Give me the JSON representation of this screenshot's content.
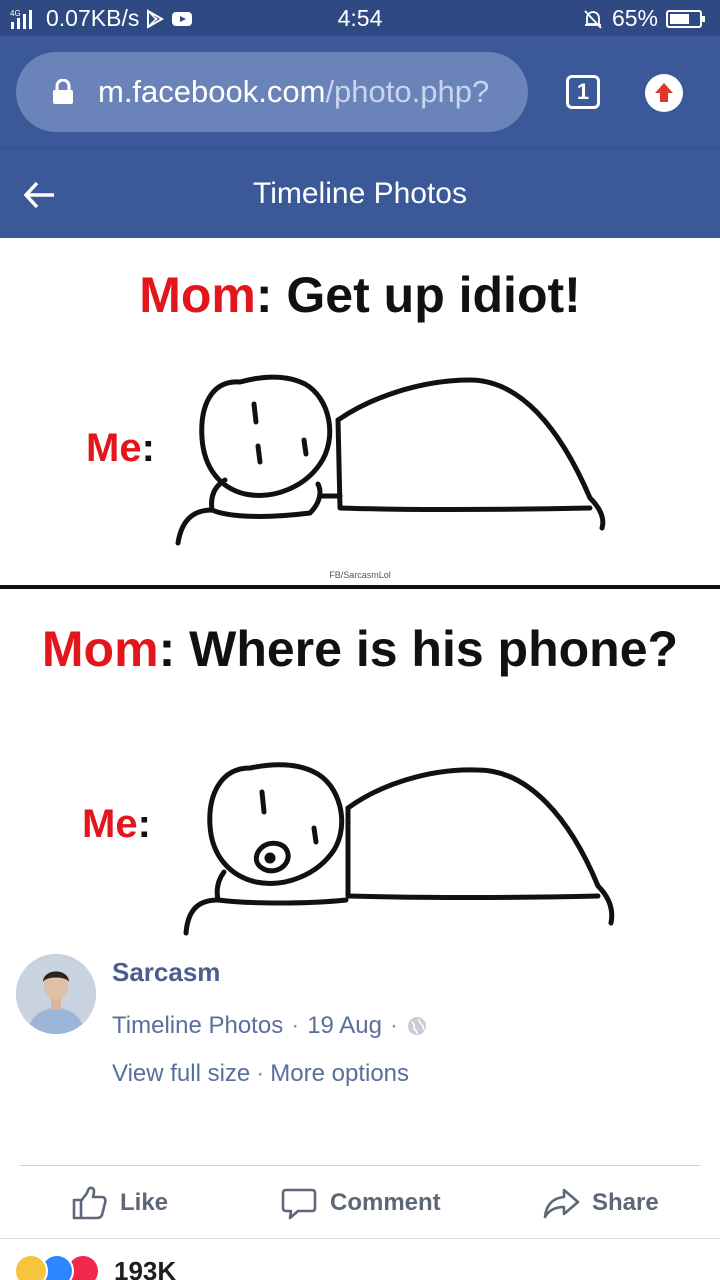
{
  "status_bar": {
    "signal": "4G",
    "speed": "0.07KB/s",
    "time": "4:54",
    "battery": "65%",
    "icons": [
      "signal-icon",
      "play-store-icon",
      "youtube-icon",
      "bell-off-icon",
      "battery-icon"
    ]
  },
  "browser": {
    "url_host": "m.facebook.com",
    "url_path": "/photo.php?",
    "tab_count": "1"
  },
  "header": {
    "title": "Timeline Photos"
  },
  "photo": {
    "panel1": {
      "caption_speaker": "Mom",
      "caption_colon": ":",
      "caption_text": "Get up idiot!",
      "me_label": "Me",
      "me_colon": ":"
    },
    "watermark": "FB/SarcasmLol",
    "panel2": {
      "caption_speaker": "Mom",
      "caption_colon": ":",
      "caption_text": "Where is his phone?",
      "me_label": "Me",
      "me_colon": ":"
    }
  },
  "post": {
    "author": "Sarcasm",
    "source": "Timeline Photos",
    "date": "19 Aug",
    "separator": "·",
    "view_full_size": "View full size",
    "more_options": "More options"
  },
  "actions": {
    "like": "Like",
    "comment": "Comment",
    "share": "Share"
  },
  "reactions": {
    "count": "193K",
    "icons": [
      "haha-icon",
      "like-reaction-icon",
      "love-icon"
    ]
  },
  "colors": {
    "facebook_blue": "#3b5998",
    "status_bar": "#2f4a82",
    "caption_red": "#e3161b"
  }
}
